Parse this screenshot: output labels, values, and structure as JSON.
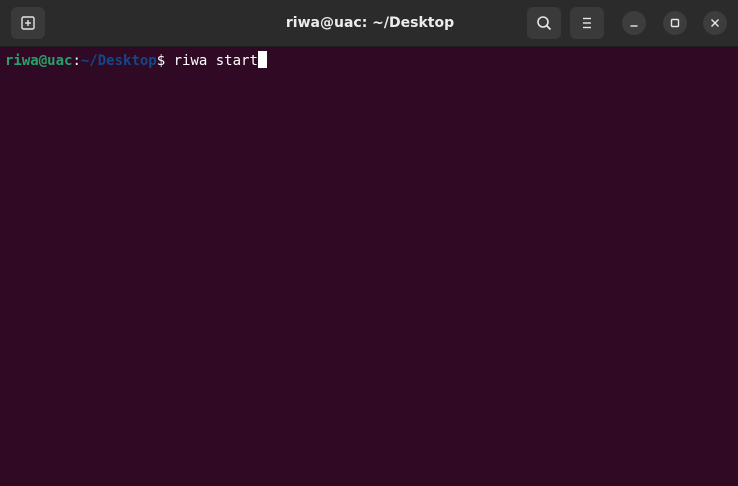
{
  "window": {
    "title": "riwa@uac: ~/Desktop"
  },
  "titlebar": {
    "new_tab_icon": "new-tab-icon",
    "search_icon": "search-icon",
    "menu_icon": "hamburger-menu-icon",
    "minimize_icon": "minimize-icon",
    "maximize_icon": "maximize-icon",
    "close_icon": "close-icon"
  },
  "terminal": {
    "prompt_user": "riwa@uac",
    "prompt_sep": ":",
    "prompt_path": "~/Desktop",
    "prompt_dollar": "$ ",
    "command": "riwa start"
  },
  "colors": {
    "background": "#300a24",
    "titlebar": "#2b2b2b",
    "prompt_user": "#26a269",
    "prompt_path": "#12488b",
    "text": "#ffffff"
  }
}
